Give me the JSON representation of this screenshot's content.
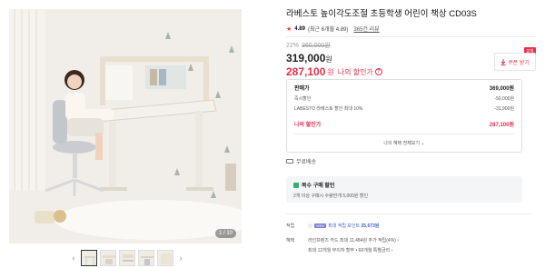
{
  "gallery": {
    "counter": "1 / 10",
    "thumbnails": [
      "thumb-1",
      "thumb-2",
      "thumb-3",
      "thumb-4",
      "thumb-5"
    ],
    "prev_icon": "chevron-left-icon",
    "next_icon": "chevron-right-icon"
  },
  "product": {
    "title": "라베스토 높이각도조절 초등학생 어린이 책상 CD03S",
    "rating": "4.89",
    "rating_detail": "(최근 6개월 4.89)",
    "review_link": "365건 리뷰",
    "discount_rate": "22%",
    "original_price": "360,000원",
    "sale_price": "319,000",
    "sale_unit": "원",
    "my_price": "287,100",
    "my_price_unit": "원",
    "my_price_label": "나의 할인가"
  },
  "coupon": {
    "badge": "0개",
    "label": "쿠폰 받기"
  },
  "price_box": {
    "list_label": "판매가",
    "list_value": "369,000원",
    "instant_label": "즉시할인",
    "instant_value": "-50,000원",
    "card_label": "LABESTO 라베스토 할인 최대 10%",
    "card_value": "-31,900원",
    "my_label": "나의 할인가",
    "my_value": "287,100원",
    "benefit_link": "나의 혜택 전체보기 ⌄"
  },
  "shipping": {
    "text": "무료배송"
  },
  "bulk": {
    "title": "복수 구매 할인",
    "desc": "2개 이상 구매시 수량한개 5,000원 할인"
  },
  "points": {
    "label": "적립",
    "badge": "WEB",
    "text": "최대 적립 포인트",
    "value": "25,673원"
  },
  "card": {
    "label": "혜택",
    "line1": "라인프렌즈 카드 최대 11,484원 추가 적립(4%) ›",
    "line2": "최대 12개월 무이자 할부 • 60개월 특별금리 ›"
  },
  "colors": {
    "accent": "#e5304c",
    "link": "#3a63c9",
    "success": "#2fb36d"
  }
}
